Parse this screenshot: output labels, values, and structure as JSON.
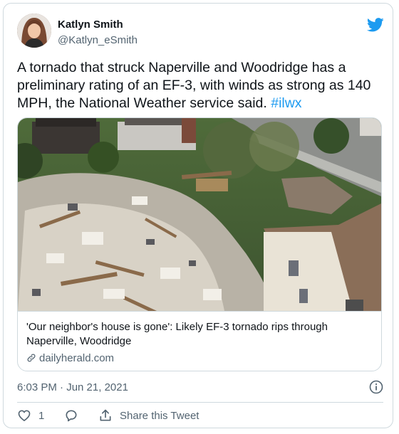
{
  "author": {
    "name": "Katlyn Smith",
    "handle": "@Katlyn_eSmith"
  },
  "tweet": {
    "text": "A tornado that struck Naperville and Woodridge has a preliminary rating of an EF-3, with winds as strong as 140 MPH, the National Weather service said.",
    "hashtag": "#ilwx"
  },
  "link_card": {
    "title": "'Our neighbor's house is gone': Likely EF-3 tornado rips through Naperville, Woodridge",
    "domain": "dailyherald.com"
  },
  "meta": {
    "timestamp": "6:03 PM · Jun 21, 2021"
  },
  "actions": {
    "like_count": "1",
    "share_label": "Share this Tweet"
  },
  "icons": {
    "brand": "twitter-bird-icon",
    "info": "info-icon",
    "like": "heart-icon",
    "reply": "reply-icon",
    "share": "share-icon",
    "link": "link-icon"
  },
  "colors": {
    "brand": "#1d9bf0",
    "text": "#0f1419",
    "secondary": "#536471",
    "border": "#cfd9de"
  }
}
